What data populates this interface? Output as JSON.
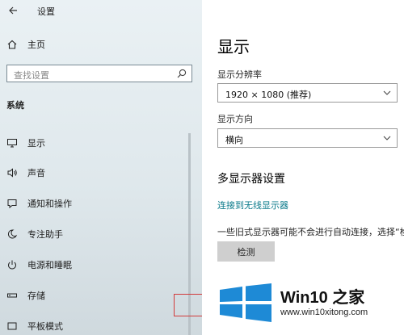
{
  "header": {
    "back_icon": "arrow-left-icon",
    "title": "设置"
  },
  "sidebar": {
    "home": {
      "icon": "home-icon",
      "label": "主页"
    },
    "search": {
      "placeholder": "查找设置",
      "icon": "search-icon"
    },
    "section_title": "系统",
    "items": [
      {
        "label": "显示",
        "icon": "monitor-icon"
      },
      {
        "label": "声音",
        "icon": "speaker-icon"
      },
      {
        "label": "通知和操作",
        "icon": "notification-icon"
      },
      {
        "label": "专注助手",
        "icon": "moon-icon"
      },
      {
        "label": "电源和睡眠",
        "icon": "power-icon"
      },
      {
        "label": "存储",
        "icon": "storage-icon"
      },
      {
        "label": "平板模式",
        "icon": "tablet-icon"
      }
    ]
  },
  "main": {
    "title": "显示",
    "resolution": {
      "label": "显示分辨率",
      "value": "1920 × 1080 (推荐)"
    },
    "orientation": {
      "label": "显示方向",
      "value": "横向"
    },
    "multi_display": {
      "heading": "多显示器设置",
      "link": "连接到无线显示器",
      "description": "一些旧式显示器可能不会进行自动连接，选择“检",
      "detect_button": "检测"
    }
  },
  "watermark": {
    "brand": "Win10 之家",
    "url": "www.win10xitong.com",
    "colors": {
      "logo": "#1e8ad6"
    }
  }
}
